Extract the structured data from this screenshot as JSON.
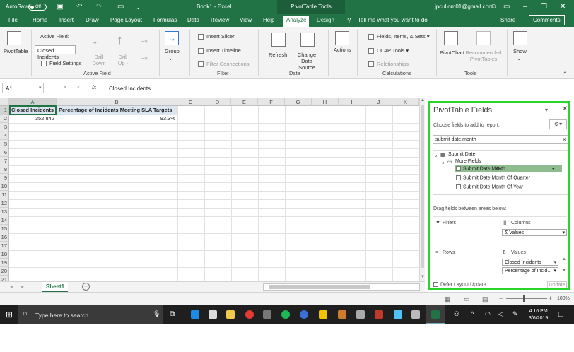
{
  "titlebar": {
    "autosave_label": "AutoSave",
    "autosave_state": "Off",
    "document_title": "Book1  -  Excel",
    "context_tools": "PivotTable Tools",
    "account": "jpcullom01@gmail.com"
  },
  "menu": {
    "items": [
      "File",
      "Home",
      "Insert",
      "Draw",
      "Page Layout",
      "Formulas",
      "Data",
      "Review",
      "View",
      "Help",
      "Analyze",
      "Design"
    ],
    "active": "Analyze",
    "tell_me": "Tell me what you want to do",
    "share": "Share",
    "comments": "Comments"
  },
  "ribbon": {
    "pivottable": "PivotTable",
    "active_field_label": "Active Field:",
    "active_field_value": "Closed Incidents",
    "field_settings": "Field Settings",
    "drill_down": "Drill Down",
    "drill_up": "Drill Up -",
    "group": "Group",
    "insert_slicer": "Insert Slicer",
    "insert_timeline": "Insert Timeline",
    "filter_connections": "Filter Connections",
    "refresh": "Refresh",
    "change_data_source": "Change Data Source",
    "actions": "Actions",
    "fields_items_sets": "Fields, Items, & Sets",
    "olap_tools": "OLAP Tools",
    "relationships": "Relationships",
    "pivotchart": "PivotChart",
    "recommended_pivottables": "Recommended PivotTables",
    "show": "Show",
    "groups": {
      "active_field": "Active Field",
      "filter": "Filter",
      "data": "Data",
      "calculations": "Calculations",
      "tools": "Tools"
    }
  },
  "formula_bar": {
    "name_box": "A1",
    "fx": "fx",
    "content": "Closed Incidents"
  },
  "grid": {
    "columns": [
      "A",
      "B",
      "C",
      "D",
      "E",
      "F",
      "G",
      "H",
      "I",
      "J",
      "K"
    ],
    "rows": [
      "1",
      "2",
      "3",
      "4",
      "5",
      "6",
      "7",
      "8",
      "9",
      "10",
      "11",
      "12",
      "13",
      "14",
      "15",
      "16",
      "17",
      "18",
      "19",
      "20",
      "21"
    ],
    "a1": "Closed Incidents",
    "b1": "Percentage of Incidents Meeting SLA Targets",
    "a2": "352,842",
    "b2": "93.3%"
  },
  "sheets": {
    "tabs": [
      "Sheet1"
    ]
  },
  "pivot_panel": {
    "title": "PivotTable Fields",
    "choose_fields": "Choose fields to add to report:",
    "search_value": "submit date.month",
    "tree": {
      "root": "Submit Date",
      "more_fields": "More Fields",
      "items": [
        "Submit Date.Month",
        "Submit Date.Month Of Quarter",
        "Submit Date.Month Of Year"
      ]
    },
    "drag_hint": "Drag fields between areas below:",
    "filters": "Filters",
    "columns": "Columns",
    "columns_value": "Σ Values",
    "rows": "Rows",
    "values": "Values",
    "values_items": [
      "Closed Incidents",
      "Percentage of Incid..."
    ],
    "defer": "Defer Layout Update",
    "update": "Update"
  },
  "status": {
    "zoom": "100%"
  },
  "taskbar": {
    "search_placeholder": "Type here to search",
    "time": "4:16 PM",
    "date": "3/6/2019"
  }
}
